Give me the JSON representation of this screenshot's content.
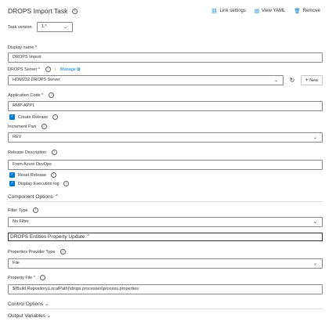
{
  "header": {
    "title": "DROPS Import Task",
    "actions": [
      {
        "icon": "link-icon",
        "label": "Link settings"
      },
      {
        "icon": "view-yaml-icon",
        "label": "View YAML"
      },
      {
        "icon": "trash-icon",
        "label": "Remove"
      }
    ]
  },
  "task_version": {
    "label": "Task version",
    "value": "1.*"
  },
  "display_name": {
    "label": "Display name *",
    "value": "DROPS Import"
  },
  "drops_server": {
    "label": "DROPS Server *",
    "manage_label": "Manage",
    "value": "HOM232 DROPS Server",
    "new_label": "New"
  },
  "application_code": {
    "label": "Application Code *",
    "value": "RMP-APP1"
  },
  "create_release": {
    "label": "Create Release",
    "checked": true
  },
  "increment_part": {
    "label": "Increment Part",
    "value": "REV"
  },
  "release_description": {
    "label": "Release Description",
    "value": "From Azure DevOps"
  },
  "reset_release": {
    "label": "Reset Release",
    "checked": true
  },
  "display_execution_log": {
    "label": "Display Execution log",
    "checked": true
  },
  "component_options": {
    "label": "Component Options"
  },
  "filter_type": {
    "label": "Filter Type",
    "value": "No Filter"
  },
  "entities_property_update": {
    "label": "DROPS Entities Property Update"
  },
  "properties_provider_type": {
    "label": "Properties Provider Type",
    "value": "File"
  },
  "property_file": {
    "label": "Property File *",
    "value": "$(Build.Repository.LocalPath)\\drops processes\\process.properties"
  },
  "control_options": {
    "label": "Control Options"
  },
  "output_variables": {
    "label": "Output Variables"
  },
  "colors": {
    "accent": "#0078d4",
    "border": "#8a8886",
    "text": "#323130"
  }
}
